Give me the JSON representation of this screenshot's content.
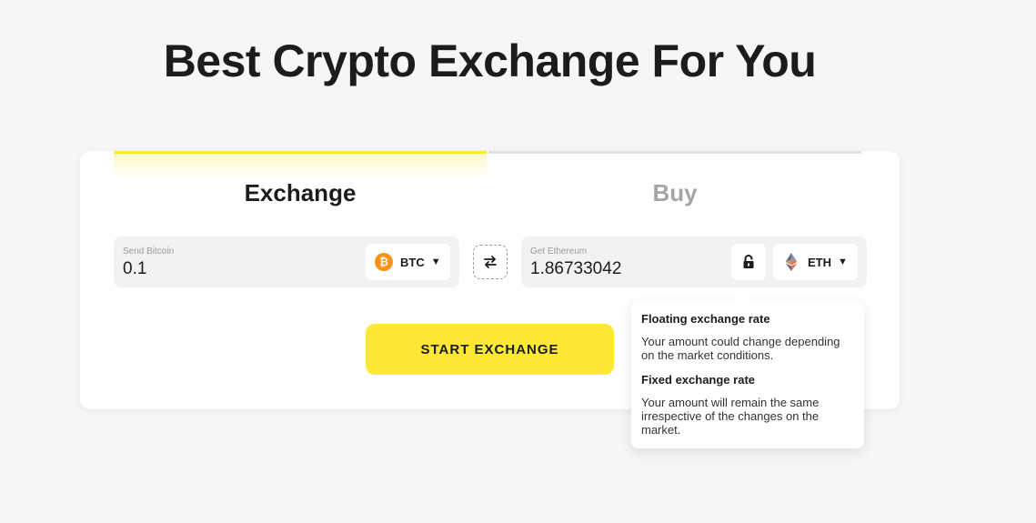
{
  "header": {
    "title": "Best Crypto Exchange For You"
  },
  "tabs": [
    {
      "label": "Exchange",
      "active": true
    },
    {
      "label": "Buy",
      "active": false
    }
  ],
  "send": {
    "label": "Send Bitcoin",
    "value": "0.1",
    "currency": {
      "code": "BTC",
      "icon": "bitcoin-icon",
      "icon_symbol": "₿",
      "color": "#f7931a"
    }
  },
  "get": {
    "label": "Get Ethereum",
    "value": "1.86733042",
    "currency": {
      "code": "ETH",
      "icon": "ethereum-icon"
    }
  },
  "actions": {
    "start_label": "START EXCHANGE"
  },
  "tooltip": {
    "floating_title": "Floating exchange rate",
    "floating_text": "Your amount could change depending on the market conditions.",
    "fixed_title": "Fixed exchange rate",
    "fixed_text": "Your amount will remain the same irrespective of the changes on the market."
  },
  "colors": {
    "accent": "#fde934",
    "background": "#f6f6f6"
  }
}
